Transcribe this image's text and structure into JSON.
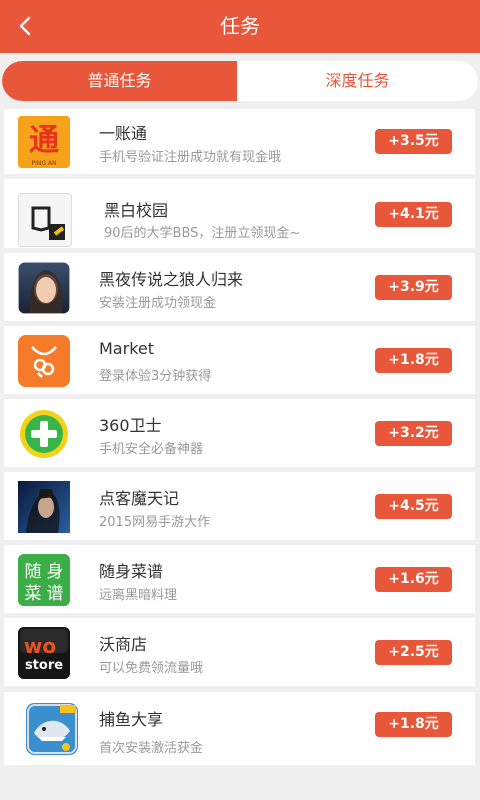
{
  "header": {
    "title": "任务",
    "back_icon": "back-arrow-icon"
  },
  "tabs": [
    {
      "label": "普通任务",
      "active": true
    },
    {
      "label": "深度任务",
      "active": false
    }
  ],
  "colors": {
    "accent": "#e8573a",
    "background": "#efefef",
    "title_text": "#333333",
    "desc_text": "#999999"
  },
  "tasks": [
    {
      "name": "一账通",
      "desc": "手机号验证注册成功就有现金哦",
      "reward": "+3.5元",
      "icon": "yizhangtong-app-icon",
      "icon_text": "PING AN"
    },
    {
      "name": "黑白校园",
      "desc": "90后的大学BBS，注册立领现金~",
      "reward": "+4.1元",
      "icon": "heibai-campus-app-icon"
    },
    {
      "name": "黑夜传说之狼人归来",
      "desc": "安装注册成功领现金",
      "reward": "+3.9元",
      "icon": "werewolf-game-app-icon"
    },
    {
      "name": "Market",
      "desc": "登录体验3分钟获得",
      "reward": "+1.8元",
      "icon": "market-app-icon"
    },
    {
      "name": "360卫士",
      "desc": "手机安全必备神器",
      "reward": "+3.2元",
      "icon": "360-security-app-icon"
    },
    {
      "name": "点客魔天记",
      "desc": "2015网易手游大作",
      "reward": "+4.5元",
      "icon": "motianji-game-app-icon"
    },
    {
      "name": "随身菜谱",
      "desc": "远离黑暗料理",
      "reward": "+1.6元",
      "icon": "recipe-app-icon",
      "icon_text": [
        "随",
        "身",
        "菜",
        "谱"
      ]
    },
    {
      "name": "沃商店",
      "desc": "可以免费领流量哦",
      "reward": "+2.5元",
      "icon": "wo-store-app-icon",
      "icon_text": [
        "wo",
        "store"
      ]
    },
    {
      "name": "捕鱼大享",
      "desc": "首次安装激活获金",
      "reward": "+1.8元",
      "icon": "fishing-game-app-icon"
    }
  ]
}
